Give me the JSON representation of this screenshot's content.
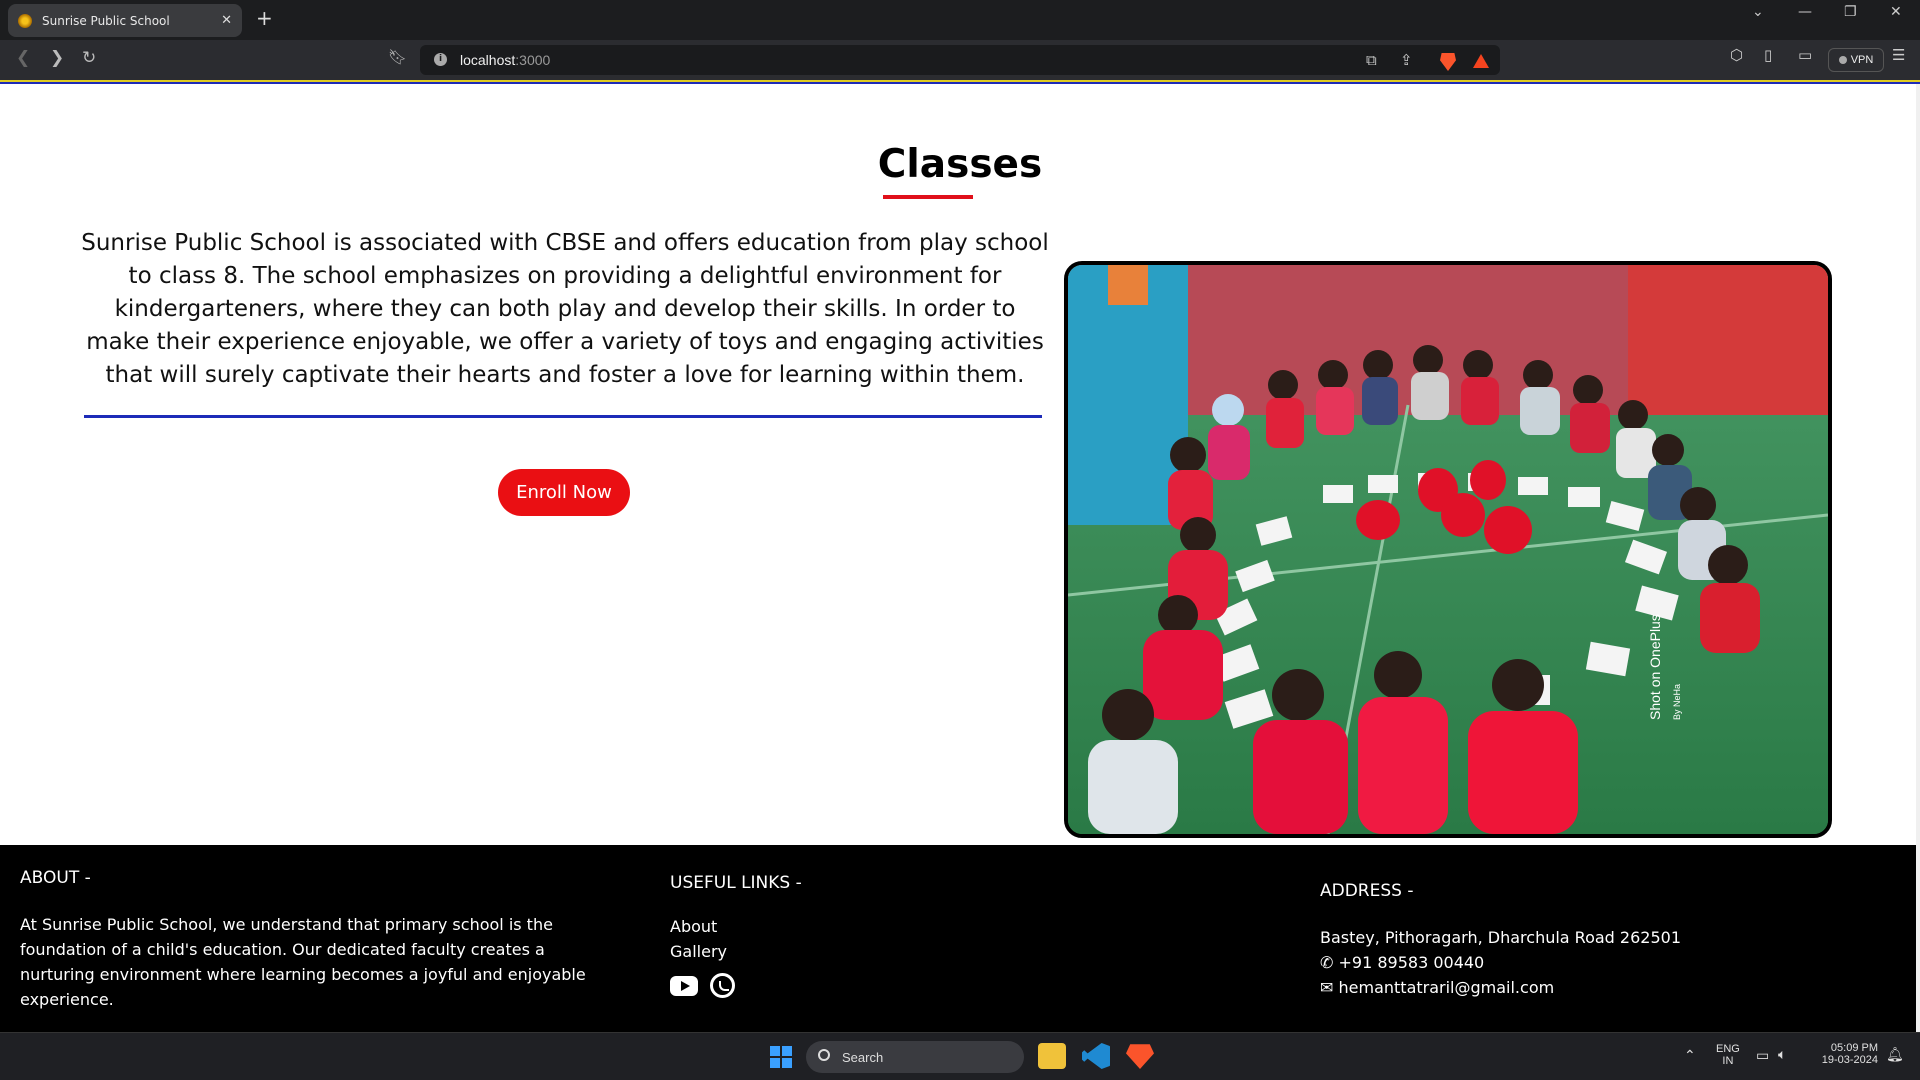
{
  "browser": {
    "tab_title": "Sunrise Public School",
    "url_host": "localhost",
    "url_port": ":3000",
    "vpn_label": "VPN"
  },
  "classes": {
    "title": "Classes",
    "description": "Sunrise Public School is associated with CBSE and offers education from play school to class 8. The school emphasizes on providing a delightful environment for kindergarteners, where they can both play and develop their skills. In order to make their experience enjoyable, we offer a variety of toys and engaging activities that will surely captivate their hearts and foster a love for learning within them.",
    "enroll_label": "Enroll Now",
    "photo_watermark": "Shot on OnePlus",
    "photo_watermark_by": "By NeHa"
  },
  "footer": {
    "about_heading": "ABOUT -",
    "about_text": "At Sunrise Public School, we understand that primary school is the foundation of a child's education. Our dedicated faculty creates a nurturing environment where learning becomes a joyful and enjoyable experience.",
    "links_heading": "USEFUL LINKS -",
    "links": [
      "About",
      "Gallery"
    ],
    "address_heading": "ADDRESS -",
    "address": "Bastey, Pithoragarh, Dharchula Road 262501",
    "phone": "+91 89583 00440",
    "email": "hemanttatraril@gmail.com"
  },
  "taskbar": {
    "search_label": "Search",
    "lang_top": "ENG",
    "lang_bottom": "IN",
    "time": "05:09 PM",
    "date": "19-03-2024"
  },
  "colors": {
    "accent_red": "#ea0f13",
    "accent_blue": "#1d2bb8",
    "footer_bg": "#000000"
  }
}
